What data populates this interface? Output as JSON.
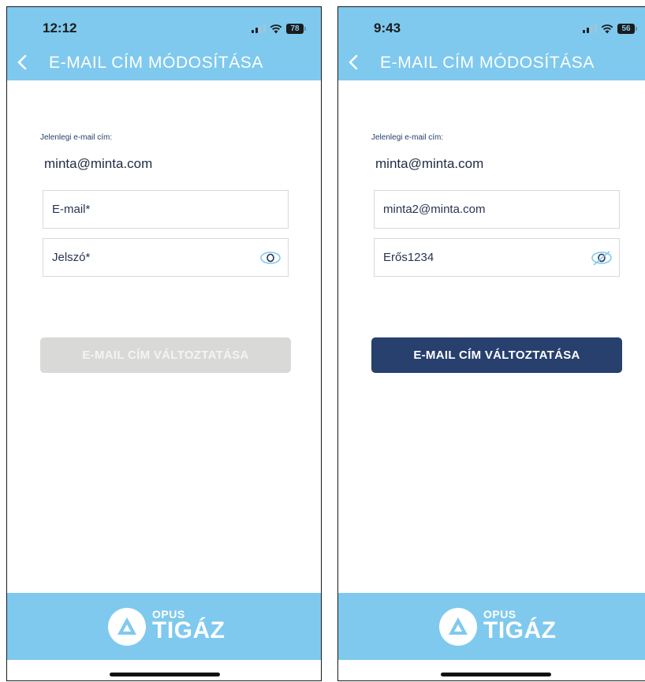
{
  "screens": [
    {
      "status": {
        "time": "12:12",
        "battery": "78"
      },
      "header": {
        "title": "E-MAIL CÍM MÓDOSÍTÁSA"
      },
      "current_email": {
        "label": "Jelenlegi e-mail cím:",
        "value": "minta@minta.com"
      },
      "email_field": {
        "text": "E-mail*"
      },
      "password_field": {
        "text": "Jelszó*",
        "eye_icon": "eye-icon"
      },
      "submit": {
        "label": "E-MAIL CÍM VÁLTOZTATÁSA",
        "state": "disabled"
      },
      "footer": {
        "logo_small": "OPUS",
        "logo_big": "TIGÁZ"
      }
    },
    {
      "status": {
        "time": "9:43",
        "battery": "56"
      },
      "header": {
        "title": "E-MAIL CÍM MÓDOSÍTÁSA"
      },
      "current_email": {
        "label": "Jelenlegi e-mail cím:",
        "value": "minta@minta.com"
      },
      "email_field": {
        "text": "minta2@minta.com"
      },
      "password_field": {
        "text": "Erős1234",
        "eye_icon": "eye-slash-icon"
      },
      "submit": {
        "label": "E-MAIL CÍM VÁLTOZTATÁSA",
        "state": "enabled"
      },
      "footer": {
        "logo_small": "OPUS",
        "logo_big": "TIGÁZ"
      }
    }
  ],
  "colors": {
    "header_bg": "#7fc9ee",
    "button_enabled": "#27406d",
    "button_disabled": "#d9d9d7",
    "text_dark_blue": "#27406b"
  }
}
